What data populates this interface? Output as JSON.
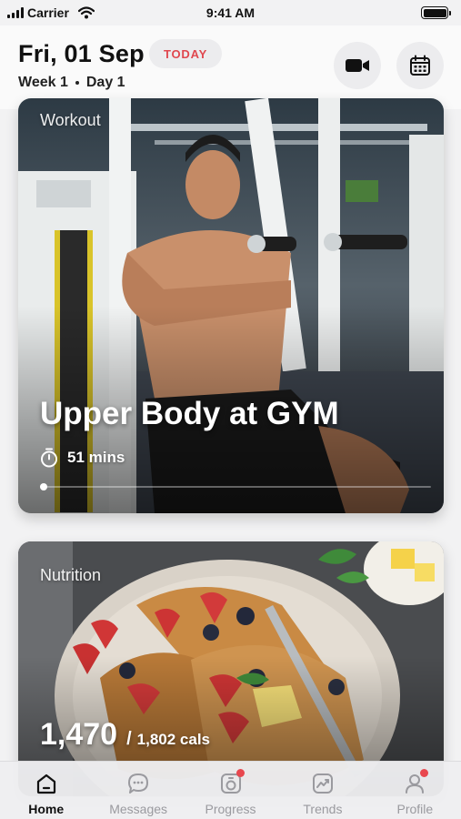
{
  "status_bar": {
    "carrier": "Carrier",
    "time": "9:41 AM"
  },
  "header": {
    "date": "Fri, 01 Sep",
    "today_badge": "TODAY",
    "week": "Week 1",
    "day": "Day 1",
    "video_icon": "video-camera-icon",
    "calendar_icon": "calendar-icon"
  },
  "workout": {
    "tag": "Workout",
    "title": "Upper Body at GYM",
    "duration": "51 mins",
    "timer_icon": "stopwatch-icon"
  },
  "nutrition": {
    "tag": "Nutrition",
    "calories_eaten": "1,470",
    "separator": "/",
    "calories_target": "1,802 cals"
  },
  "tabs": [
    {
      "label": "Home",
      "icon": "home-icon",
      "active": true,
      "badge": false
    },
    {
      "label": "Messages",
      "icon": "chat-bubble-icon",
      "active": false,
      "badge": false
    },
    {
      "label": "Progress",
      "icon": "progress-icon",
      "active": false,
      "badge": true
    },
    {
      "label": "Trends",
      "icon": "trends-icon",
      "active": false,
      "badge": false
    },
    {
      "label": "Profile",
      "icon": "profile-icon",
      "active": false,
      "badge": true
    }
  ],
  "colors": {
    "accent": "#e0484f",
    "badge_dot": "#e8474e",
    "active_tab": "#111111",
    "inactive_tab": "#9a9a9f"
  }
}
